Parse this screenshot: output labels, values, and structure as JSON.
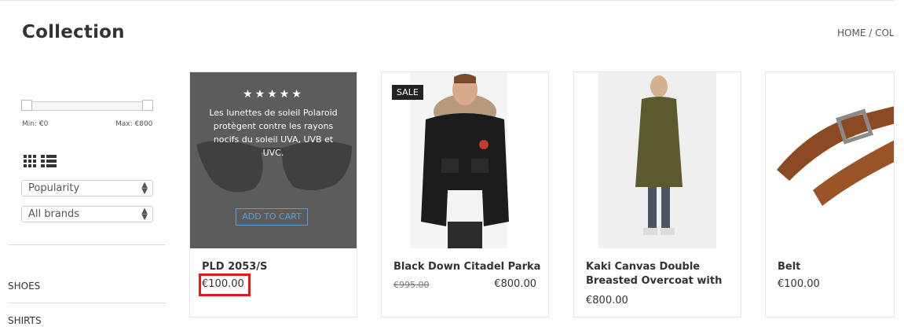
{
  "header": {
    "title": "Collection",
    "breadcrumb": "HOME / COL"
  },
  "sidebar": {
    "price_filter": {
      "min_label": "Min: €0",
      "max_label": "Max: €800"
    },
    "view_icons": [
      "grid-view-icon",
      "list-view-icon"
    ],
    "sort_select": "Popularity",
    "brand_select": "All brands",
    "categories": [
      "SHOES",
      "SHIRTS"
    ]
  },
  "products": [
    {
      "name": "PLD 2053/S",
      "price": "€100.00",
      "overlay": {
        "stars": "★★★★★",
        "description": "Les lunettes de soleil Polaroid protègent contre les rayons nocifs du soleil UVA, UVB et UVC.",
        "button": "ADD TO CART"
      }
    },
    {
      "name": "Black Down Citadel Parka",
      "badge": "SALE",
      "old_price": "€995.00",
      "price": "€800.00"
    },
    {
      "name": "Kaki Canvas Double Breasted Overcoat with",
      "price": "€800.00"
    },
    {
      "name": "Belt",
      "price": "€100.00"
    }
  ],
  "colors": {
    "highlight": "#e01b1b",
    "overlay": "#464646",
    "accent_blue": "#5a9fd8"
  }
}
